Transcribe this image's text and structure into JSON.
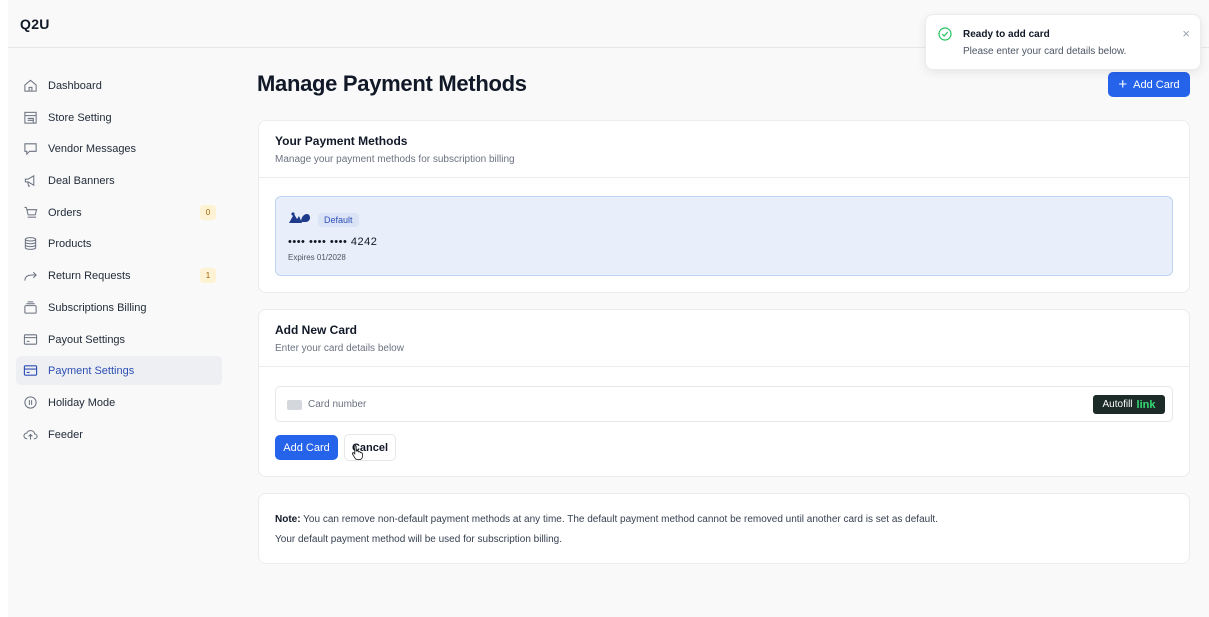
{
  "app": {
    "brand": "Q2U"
  },
  "sidebar": {
    "items": [
      {
        "label": "Dashboard",
        "icon": "home-icon"
      },
      {
        "label": "Store Setting",
        "icon": "store-icon"
      },
      {
        "label": "Vendor Messages",
        "icon": "message-icon"
      },
      {
        "label": "Deal Banners",
        "icon": "megaphone-icon"
      },
      {
        "label": "Orders",
        "icon": "cart-icon",
        "badge": "0"
      },
      {
        "label": "Products",
        "icon": "database-icon"
      },
      {
        "label": "Return Requests",
        "icon": "forward-arrow-icon",
        "badge": "1"
      },
      {
        "label": "Subscriptions Billing",
        "icon": "layers-icon"
      },
      {
        "label": "Payout Settings",
        "icon": "wallet-icon"
      },
      {
        "label": "Payment Settings",
        "icon": "credit-card-icon",
        "active": true
      },
      {
        "label": "Holiday Mode",
        "icon": "pause-circle-icon"
      },
      {
        "label": "Feeder",
        "icon": "upload-cloud-icon"
      }
    ]
  },
  "main": {
    "title": "Manage Payment Methods",
    "add_card_label": "Add Card",
    "payment_methods": {
      "title": "Your Payment Methods",
      "subtitle": "Manage your payment methods for subscription billing",
      "card": {
        "brand_icon": "card-brand-logo",
        "badge": "Default",
        "number": "•••• •••• •••• 4242",
        "expires": "Expires 01/2028"
      }
    },
    "add_new": {
      "title": "Add New Card",
      "subtitle": "Enter your card details below",
      "placeholder": "Card number",
      "autofill_text": "Autofill",
      "autofill_link": "link",
      "submit_label": "Add Card",
      "cancel_label": "Cancel"
    },
    "note": {
      "prefix": "Note:",
      "line1": " You can remove non-default payment methods at any time. The default payment method cannot be removed until another card is set as default.",
      "line2": "Your default payment method will be used for subscription billing."
    }
  },
  "toast": {
    "title": "Ready to add card",
    "message": "Please enter your card details below.",
    "icon": "check-circle-icon"
  },
  "colors": {
    "accent": "#2563eb",
    "active_nav": "#2d4fb6",
    "success": "#22c55e"
  }
}
